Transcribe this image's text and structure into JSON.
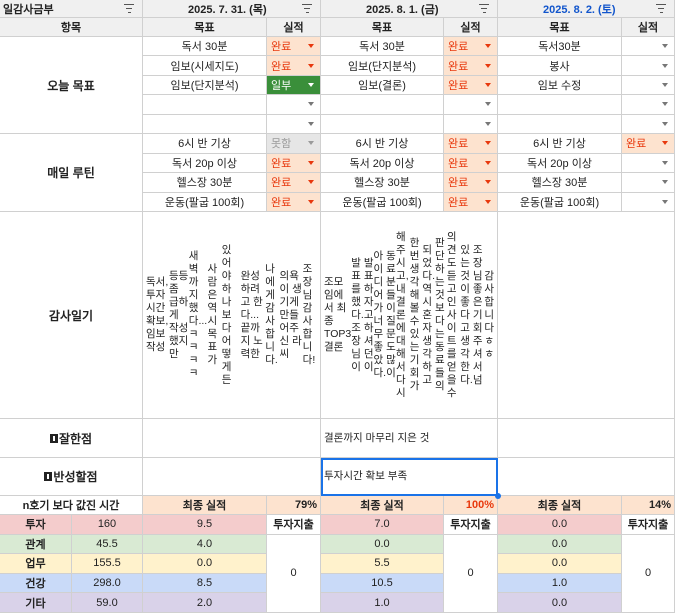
{
  "header": {
    "sheet_title": "일감사금부",
    "dates": [
      "2025. 7. 31. (목)",
      "2025. 8. 1. (금)",
      "2025. 8. 2. (토)"
    ]
  },
  "columns": {
    "item": "항목",
    "goal": "목표",
    "result": "실적"
  },
  "sections": {
    "today_goal": "오늘 목표",
    "daily_routine": "매일 루틴",
    "gratitude": "감사일기",
    "good": "잘한점",
    "reflect": "반성할점"
  },
  "today_goals": [
    [
      {
        "goal": "독서 30분",
        "status": "완료"
      },
      {
        "goal": "독서 30분",
        "status": "완료"
      },
      {
        "goal": "독서30분",
        "status": ""
      }
    ],
    [
      {
        "goal": "임보(시세지도)",
        "status": "완료"
      },
      {
        "goal": "임보(단지분석)",
        "status": "완료"
      },
      {
        "goal": "봉사",
        "status": ""
      }
    ],
    [
      {
        "goal": "임보(단지분석)",
        "status": "일부"
      },
      {
        "goal": "임보(결론)",
        "status": "완료"
      },
      {
        "goal": "임보 수정",
        "status": ""
      }
    ],
    [
      {
        "goal": "",
        "status": ""
      },
      {
        "goal": "",
        "status": ""
      },
      {
        "goal": "",
        "status": ""
      }
    ],
    [
      {
        "goal": "",
        "status": ""
      },
      {
        "goal": "",
        "status": ""
      },
      {
        "goal": "",
        "status": ""
      }
    ]
  ],
  "routines": [
    [
      {
        "goal": "6시 반 기상",
        "status": "못함"
      },
      {
        "goal": "6시 반 기상",
        "status": "완료"
      },
      {
        "goal": "6시 반 기상",
        "status": "완료"
      }
    ],
    [
      {
        "goal": "독서 20p 이상",
        "status": "완료"
      },
      {
        "goal": "독서 20p 이상",
        "status": "완료"
      },
      {
        "goal": "독서 20p 이상",
        "status": ""
      }
    ],
    [
      {
        "goal": "헬스장 30분",
        "status": "완료"
      },
      {
        "goal": "헬스장 30분",
        "status": "완료"
      },
      {
        "goal": "헬스장 30분",
        "status": ""
      }
    ],
    [
      {
        "goal": "운동(팔굽 100회)",
        "status": "완료"
      },
      {
        "goal": "운동(팔굽 100회)",
        "status": "완료"
      },
      {
        "goal": "운동(팔굽 100회)",
        "status": ""
      }
    ]
  ],
  "gratitude": [
    [
      "독서, 투자시간 확보, 임보 작성",
      "등등 좀 급하게 작성했지만",
      "새벽까지 했다...ㅋㅋㅋㅋ",
      "사람은 역시 목표가",
      "있어야하나보다 어떻게든",
      "완성하려고 한다... 끝까지 노력한",
      "나에게 감사합니다.",
      "의욕이 생기게 만들어주신 라씨",
      "조장님 감사합니다!"
    ],
    [
      "조모임에서 최종 TOP3 결론",
      "발표를 했다. 조장님이",
      "발표하자고 하셔던 이",
      "아이디어가 너무 좋았다.",
      "동료분들이 질문도 많이",
      "해주시고, 내 결론에 대해서 다시",
      "한 번 생각해볼 수 있는 기회가",
      "되었다. 역시 혼자 생각하고",
      "판단하는 것보다는 동료들의",
      "의견도 듣고 인사이트를 얻을 수",
      "있는 것이 좋다고 생각한다.",
      "조장님 좋은 기회 주셔서 넘",
      "감사합니다ㅎㅎ"
    ],
    []
  ],
  "good_points": [
    "",
    "결론까지 마무리 지은 것",
    ""
  ],
  "reflect_points": [
    "",
    "투자시간 확보 부족",
    ""
  ],
  "summary": {
    "header": "n호기 보다 값진 시간",
    "final_label": "최종 실적",
    "invest_out_label": "투자지출",
    "pcts": [
      "79%",
      "100%",
      "14%"
    ],
    "categories": [
      {
        "name": "투자",
        "total": "160",
        "days": [
          "9.5",
          "7.0",
          "0.0"
        ]
      },
      {
        "name": "관계",
        "total": "45.5",
        "days": [
          "4.0",
          "0.0",
          "0.0"
        ]
      },
      {
        "name": "업무",
        "total": "155.5",
        "days": [
          "0.0",
          "5.5",
          "0.0"
        ]
      },
      {
        "name": "건강",
        "total": "298.0",
        "days": [
          "8.5",
          "10.5",
          "1.0"
        ]
      },
      {
        "name": "기타",
        "total": "59.0",
        "days": [
          "2.0",
          "1.0",
          "0.0"
        ]
      }
    ],
    "invest_out": [
      "0",
      "0",
      "0"
    ]
  },
  "colors": {
    "done_bg": "#fde3cf",
    "done_fg": "#e8380d",
    "partial_bg": "#3a8f3a",
    "missed_bg": "#e6e6e6",
    "date_sat": "#1155cc",
    "selection": "#1a73e8"
  }
}
